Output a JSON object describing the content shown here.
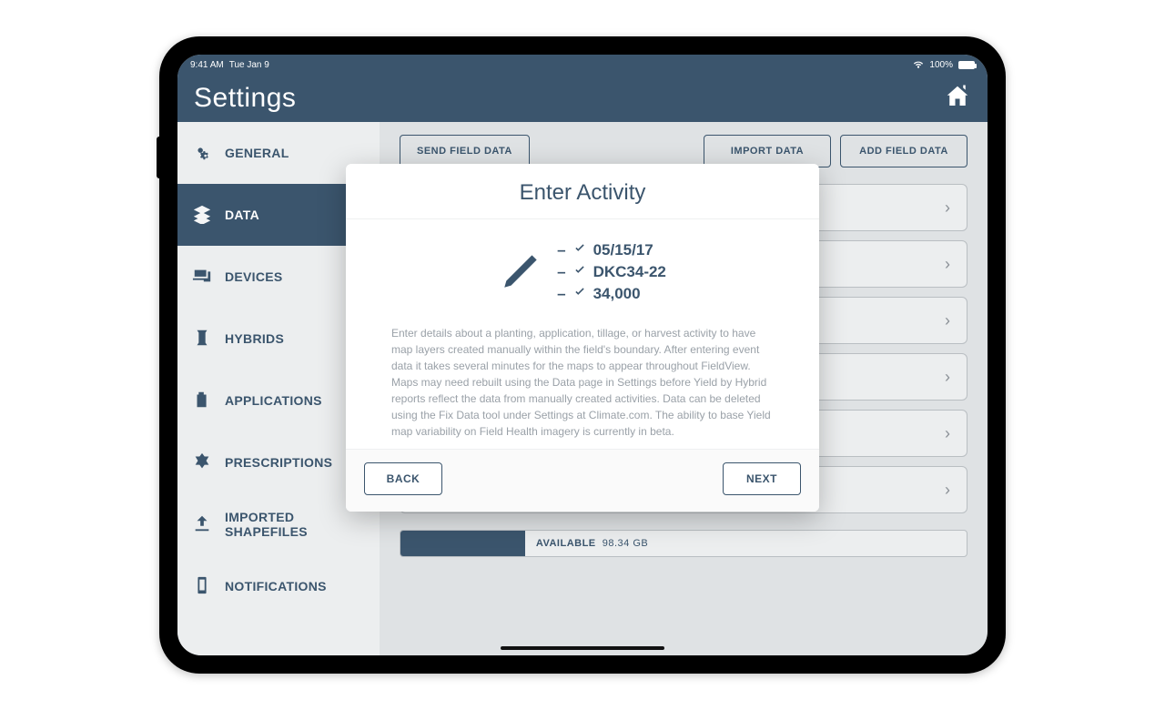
{
  "status": {
    "time": "9:41 AM",
    "date": "Tue Jan 9",
    "battery": "100%"
  },
  "header": {
    "title": "Settings"
  },
  "sidebar": {
    "items": [
      {
        "label": "GENERAL",
        "icon": "gears-icon"
      },
      {
        "label": "DATA",
        "icon": "layers-icon",
        "active": true
      },
      {
        "label": "DEVICES",
        "icon": "devices-icon"
      },
      {
        "label": "HYBRIDS",
        "icon": "seed-bag-icon"
      },
      {
        "label": "APPLICATIONS",
        "icon": "jug-icon"
      },
      {
        "label": "PRESCRIPTIONS",
        "icon": "rx-icon"
      },
      {
        "label": "IMPORTED SHAPEFILES",
        "icon": "import-icon"
      },
      {
        "label": "NOTIFICATIONS",
        "icon": "phone-icon"
      }
    ]
  },
  "toolbar": {
    "send_label": "SEND FIELD DATA",
    "import_label": "IMPORT DATA",
    "add_label": "ADD FIELD DATA"
  },
  "storage": {
    "available_label": "AVAILABLE",
    "available_value": "98.34 GB",
    "used_fraction": 0.22
  },
  "modal": {
    "title": "Enter Activity",
    "lines": [
      "05/15/17",
      "DKC34-22",
      "34,000"
    ],
    "body": "Enter details about a planting, application, tillage, or harvest activity to have map layers created manually within the field's boundary. After entering event data it takes several minutes for the maps to appear throughout FieldView. Maps may need rebuilt using the Data page in Settings before Yield by Hybrid reports reflect the data from manually created activities. Data can be deleted using the Fix Data tool under Settings at Climate.com. The ability to base Yield map variability on Field Health imagery is currently in beta.",
    "back_label": "BACK",
    "next_label": "NEXT"
  }
}
